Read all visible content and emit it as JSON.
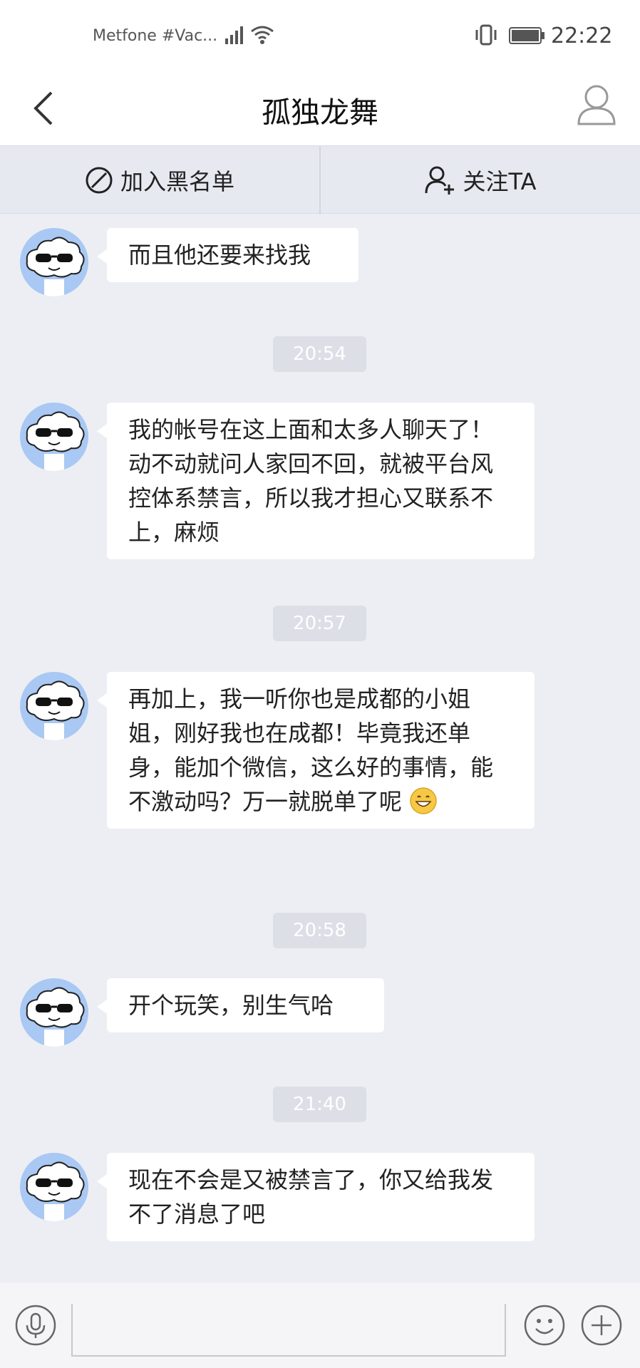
{
  "status_bar": {
    "carrier": "Metfone #Vac...",
    "time": "22:22"
  },
  "header": {
    "title": "孤独龙舞"
  },
  "actions": {
    "blacklist_label": "加入黑名单",
    "follow_label": "关注TA"
  },
  "messages": [
    {
      "text": "而且他还要来找我"
    },
    {
      "timestamp": "20:54"
    },
    {
      "text": "我的帐号在这上面和太多人聊天了！动不动就问人家回不回，就被平台风控体系禁言，所以我才担心又联系不上，麻烦"
    },
    {
      "timestamp": "20:57"
    },
    {
      "text": "再加上，我一听你也是成都的小姐姐，刚好我也在成都！毕竟我还单身，能加个微信，这么好的事情，能不激动吗？万一就脱单了呢"
    },
    {
      "timestamp": "20:58"
    },
    {
      "text": "开个玩笑，别生气哈"
    },
    {
      "timestamp": "21:40"
    },
    {
      "text": "现在不会是又被禁言了，你又给我发不了消息了吧"
    }
  ],
  "icons": {
    "back": "chevron-left-icon",
    "profile": "user-icon",
    "blacklist": "ban-icon",
    "follow": "add-user-icon",
    "mic": "microphone-icon",
    "emoji": "smile-icon",
    "more": "plus-icon",
    "inline_emoji": "grinning-face-emoji"
  },
  "colors": {
    "chat_background": "#eceef3",
    "action_bar_background": "#e6e9f0",
    "avatar_background": "#a9c8f3",
    "timestamp_background": "#dcdfe6"
  }
}
